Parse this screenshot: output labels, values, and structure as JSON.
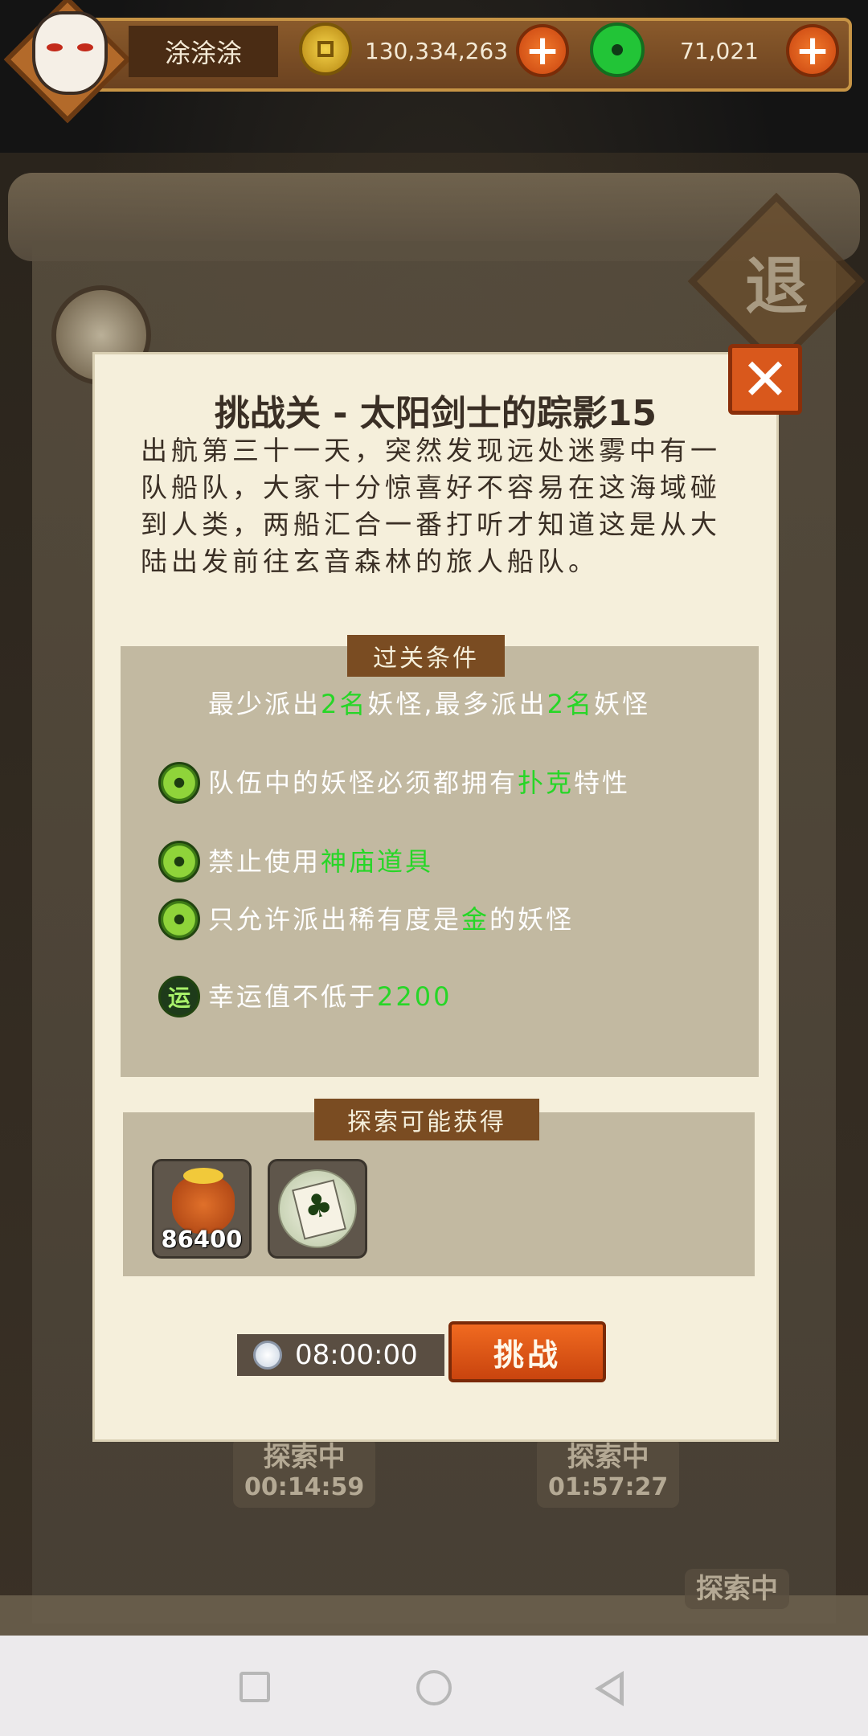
{
  "topbar": {
    "player_name": "涂涂涂",
    "gold": "130,334,263",
    "jade": "71,021",
    "icons": {
      "avatar": "fox-mask-avatar-icon",
      "gold": "gold-coin-icon",
      "jade": "jade-coin-icon",
      "add": "plus-icon"
    }
  },
  "background": {
    "back_label": "退",
    "explore_1_label": "探索中",
    "explore_1_timer": "00:14:59",
    "explore_2_label": "探索中",
    "explore_2_timer": "01:57:27",
    "explore_3_label": "探索中"
  },
  "modal": {
    "title": "挑战关 - 太阳剑士的踪影15",
    "story": "出航第三十一天，突然发现远处迷雾中有一队船队，大家十分惊喜好不容易在这海域碰到人类，两船汇合一番打听才知道这是从大陆出发前往玄音森林的旅人船队。",
    "conditions_title": "过关条件",
    "conditions": [
      {
        "pre": "最少派出",
        "hl1": "2名",
        "mid": "妖怪,最多派出",
        "hl2": "2名",
        "post": "妖怪"
      },
      {
        "pre": "队伍中的妖怪必须都拥有",
        "hl1": "扑克",
        "post": "特性"
      },
      {
        "pre": "禁止使用",
        "hl1": "神庙道具",
        "post": ""
      },
      {
        "pre": "只允许派出稀有度是",
        "hl1": "金",
        "post": "的妖怪"
      },
      {
        "pre": "幸运值不低于",
        "hl1": "2200",
        "post": "",
        "icon_label": "运"
      }
    ],
    "rewards_title": "探索可能获得",
    "rewards": [
      {
        "icon": "gold-bag-icon",
        "quantity": "86400"
      },
      {
        "icon": "clover-card-icon",
        "quantity": ""
      }
    ],
    "timer": "08:00:00",
    "challenge_label": "挑战",
    "close_label": "✕"
  },
  "colors": {
    "highlight": "#27d627",
    "accent_orange": "#d9581c",
    "panel": "#c2b9a1",
    "parchment": "#f5efdb"
  }
}
